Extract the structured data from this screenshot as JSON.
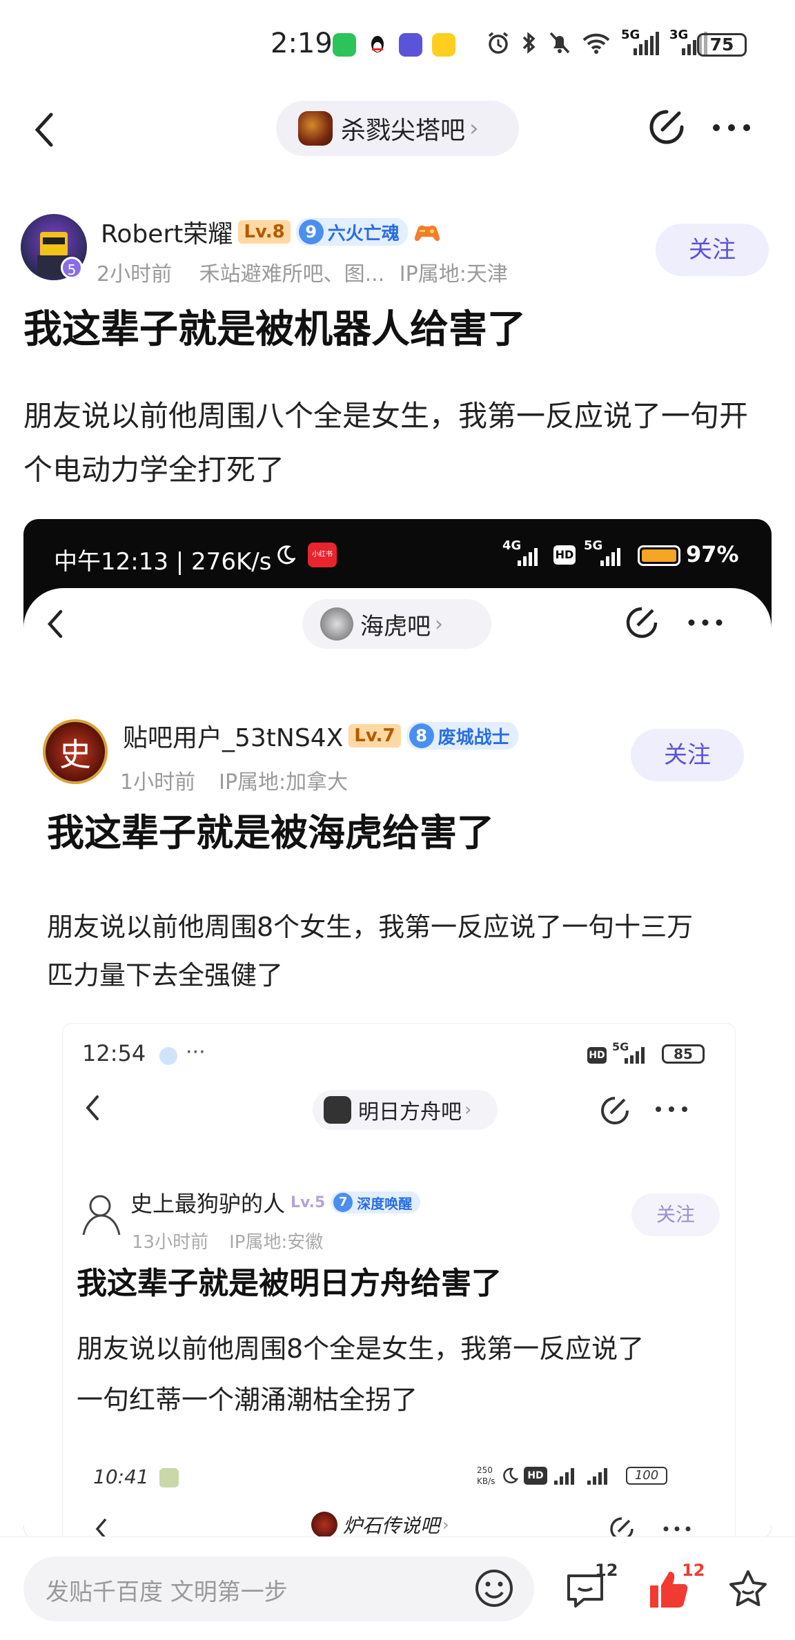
{
  "status_bar": {
    "time": "2:19",
    "battery": "75",
    "net1": "5G",
    "net2": "3G"
  },
  "nav": {
    "forum_name": "杀戮尖塔吧",
    "chevron": "›"
  },
  "post": {
    "author": "Robert荣耀",
    "level": "Lv.8",
    "medal_num": "9",
    "medal_name": "六火亡魂",
    "avatar_badge": "5",
    "time": "2小时前",
    "forums": "禾站避难所吧、图...",
    "ip": "IP属地:天津",
    "follow": "关注",
    "title": "我这辈子就是被机器人给害了",
    "body": "朋友说以前他周围八个全是女生，我第一反应说了一句开个电动力学全打死了"
  },
  "screenshot": {
    "status_time": "中午12:13 | 276K/s",
    "app_badge": "小红书",
    "net1": "4G",
    "hd": "HD",
    "net2": "5G",
    "battery": "97%",
    "forum_name": "海虎吧",
    "author": "贴吧用户_53tNS4X",
    "level": "Lv.7",
    "medal_num": "8",
    "medal_name": "废城战士",
    "avatar_char": "史",
    "time": "1小时前",
    "ip": "IP属地:加拿大",
    "follow": "关注",
    "title": "我这辈子就是被海虎给害了",
    "body_line1": "朋友说以前他周围8个女生，我第一反应说了一句十三万",
    "body_line2": "匹力量下去全强健了",
    "nested": {
      "time": "12:54",
      "hd": "HD",
      "net": "5G",
      "battery": "85",
      "forum_name": "明日方舟吧",
      "author": "史上最狗驴的人",
      "level": "Lv.5",
      "medal_num": "7",
      "medal_name": "深度唤醒",
      "post_time": "13小时前",
      "ip": "IP属地:安徽",
      "follow": "关注",
      "title": "我这辈子就是被明日方舟给害了",
      "body_line1": "朋友说以前他周围8个全是女生，我第一反应说了",
      "body_line2": "一句红蒂一个潮涌潮枯全拐了",
      "deep": {
        "time": "10:41",
        "speed_top": "250",
        "speed_bot": "KB/s",
        "hd": "HD",
        "battery": "100",
        "forum_name": "炉石传说吧"
      }
    }
  },
  "bottom_bar": {
    "placeholder": "发贴千百度 文明第一步",
    "comment_count": "12",
    "like_count": "12"
  },
  "colors": {
    "accent": "#5a54d8",
    "like": "#f03a32",
    "lv_bg": "#ffd9a3",
    "medal": "#4a8ff0"
  }
}
